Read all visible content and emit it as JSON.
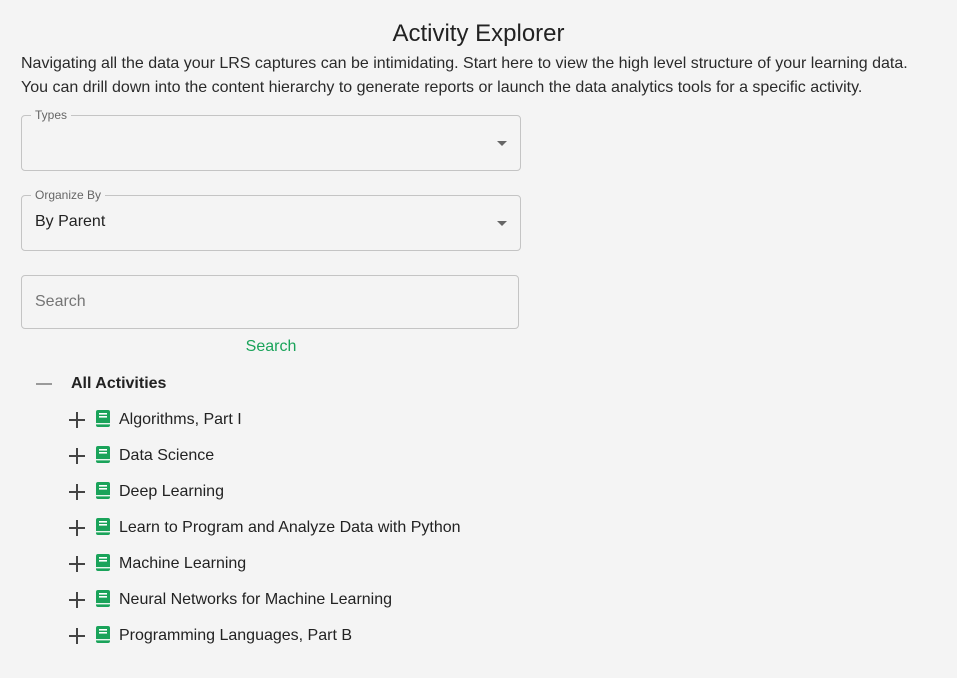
{
  "page": {
    "title": "Activity Explorer",
    "description_line1": "Navigating all the data your LRS captures can be intimidating. Start here to view the high level structure of your learning data.",
    "description_line2": "You can drill down into the content hierarchy to generate reports or launch the data analytics tools for a specific activity."
  },
  "filters": {
    "types_label": "Types",
    "types_value": "",
    "organize_label": "Organize By",
    "organize_value": "By Parent"
  },
  "search": {
    "placeholder": "Search",
    "button_label": "Search"
  },
  "tree": {
    "root_label": "All Activities",
    "items": [
      {
        "label": "Algorithms, Part I"
      },
      {
        "label": "Data Science"
      },
      {
        "label": "Deep Learning"
      },
      {
        "label": "Learn to Program and Analyze Data with Python"
      },
      {
        "label": "Machine Learning"
      },
      {
        "label": "Neural Networks for Machine Learning"
      },
      {
        "label": "Programming Languages, Part B"
      }
    ]
  },
  "colors": {
    "accent": "#1aa35a",
    "background": "#f4f4f4"
  },
  "icons": {
    "expand": "plus-icon",
    "collapse": "minus-icon",
    "activity": "book-icon",
    "dropdown": "caret-down-icon"
  }
}
